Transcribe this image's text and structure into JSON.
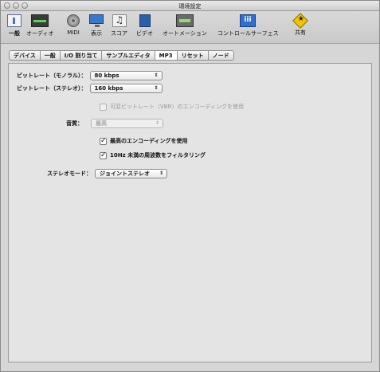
{
  "window": {
    "title": "環境設定"
  },
  "toolbar": {
    "items": [
      {
        "label": "一般",
        "icon": "general-icon"
      },
      {
        "label": "オーディオ",
        "icon": "audio-icon"
      },
      {
        "label": "MIDI",
        "icon": "midi-icon"
      },
      {
        "label": "表示",
        "icon": "display-icon"
      },
      {
        "label": "スコア",
        "icon": "score-icon"
      },
      {
        "label": "ビデオ",
        "icon": "video-icon"
      },
      {
        "label": "オートメーション",
        "icon": "automation-icon"
      },
      {
        "label": "コントロールサーフェス",
        "icon": "control-surface-icon"
      },
      {
        "label": "共有",
        "icon": "share-icon"
      }
    ]
  },
  "tabs": [
    {
      "label": "デバイス"
    },
    {
      "label": "一般"
    },
    {
      "label": "I/O 割り当て"
    },
    {
      "label": "サンプルエディタ"
    },
    {
      "label": "MP3",
      "selected": true
    },
    {
      "label": "リセット"
    },
    {
      "label": "ノード"
    }
  ],
  "mp3": {
    "bitrate_mono_label": "ビットレート（モノラル）：",
    "bitrate_mono_value": "80 kbps",
    "bitrate_stereo_label": "ビットレート（ステレオ）：",
    "bitrate_stereo_value": "160 kbps",
    "vbr_label": "可変ビットレート（VBR）のエンコーディングを使用",
    "quality_label": "音質：",
    "quality_value": "最高",
    "best_encoding_label": "最高のエンコーディングを使用",
    "filter_label": "10Hz 未満の周波数をフィルタリング",
    "stereo_mode_label": "ステレオモード：",
    "stereo_mode_value": "ジョイントステレオ"
  }
}
